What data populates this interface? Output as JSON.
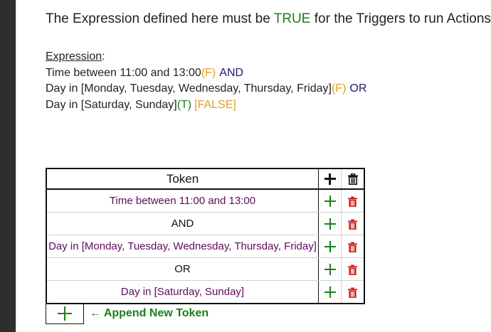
{
  "heading": {
    "prefix": "The Expression defined here must be ",
    "true_word": "TRUE",
    "suffix": " for the Triggers to run Actions"
  },
  "expression": {
    "label": "Expression",
    "colon": ":",
    "lines": [
      {
        "text": "Time between 11:00 and 13:00",
        "state": "(F)",
        "op": "AND"
      },
      {
        "text": "Day in [Monday, Tuesday, Wednesday, Thursday, Friday]",
        "state": "(F)",
        "op": "OR"
      },
      {
        "text": "Day in [Saturday, Sunday]",
        "state": "(T)",
        "result": "[FALSE]"
      }
    ]
  },
  "table": {
    "header": "Token",
    "rows": [
      {
        "token": "Time between 11:00 and 13:00",
        "kind": "term"
      },
      {
        "token": "AND",
        "kind": "operator"
      },
      {
        "token": "Day in [Monday, Tuesday, Wednesday, Thursday, Friday]",
        "kind": "term"
      },
      {
        "token": "OR",
        "kind": "operator"
      },
      {
        "token": "Day in [Saturday, Sunday]",
        "kind": "term"
      }
    ]
  },
  "append": {
    "label": "← Append New Token"
  },
  "colors": {
    "true_green": "#1a7f1a",
    "false_amber": "#e0a020",
    "operator_navy": "#1a1a6e",
    "term_purple": "#5e0b5e",
    "delete_red": "#d11a1a"
  },
  "icons": {
    "add": "plus-icon",
    "delete": "trash-icon"
  }
}
